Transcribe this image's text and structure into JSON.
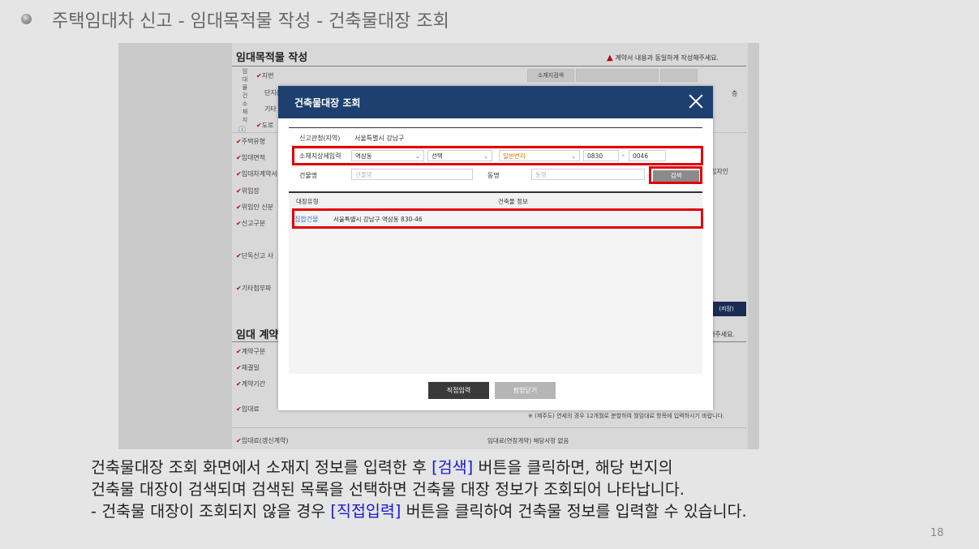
{
  "slide": {
    "title": "주택임대차 신고 - 임대목적물 작성 - 건축물대장 조회",
    "page_number": "18",
    "description": {
      "line1_a": "건축물대장 조회 화면에서 소재지 정보를 입력한 후 ",
      "line1_hl": "[검색]",
      "line1_b": " 버튼을 클릭하면, 해당 번지의",
      "line2": "건축물 대장이 검색되며 검색된 목록을 선택하면 건축물 대장 정보가 조회되어 나타납니다.",
      "line3_a": "- 건축물 대장이 조회되지 않을 경우 ",
      "line3_hl": "[직접입력]",
      "line3_b": " 버튼을 클릭하여 건축물 정보를 입력할 수 있습니다."
    }
  },
  "form": {
    "section1_title": "임대목적물 작성",
    "warning": "계약서 내용과 동일하게 작성해주세요.",
    "vertical_label": "임대물건소재지",
    "jibun_label": "지번",
    "danji_label": "단지(",
    "etc_label": "기타",
    "road_label": "도로",
    "search_address_btn": "소재지검색",
    "rows": [
      "주택유형",
      "임대면적",
      "임대차계약서",
      "위임장",
      "위임인 신분",
      "신고구분",
      "단독신고 사",
      "기타첨부파"
    ],
    "right_note": "임자인",
    "save_label": "(저장)",
    "section2_title": "임대 계약",
    "section2_warning": "해주세요.",
    "contract_rows": [
      "계약구분",
      "체결일",
      "계약기간",
      "임대료",
      "임대료(갱신계약)"
    ],
    "jeju_note": "※ (제주도) 연세의 경우 12개월로 분할하여 월임대료 항목에 입력하시기 바랍니다.",
    "renewal_note": "임대료(연장계약) 해당사항 없음",
    "item_suffix": "층"
  },
  "modal": {
    "title": "건축물대장 조회",
    "jurisdiction_label": "신고관청(지역)",
    "jurisdiction_value": "서울특별시 강남구",
    "address_detail_label": "소재지상세입력",
    "dong_select": "역삼동",
    "type_select": "선택",
    "bunji_select": "일반번지",
    "bun_value": "0830",
    "dash": "-",
    "ji_value": "0046",
    "building_name_label": "건물명",
    "building_name_placeholder": "건물명",
    "dong_label": "동명",
    "dong_placeholder": "동명",
    "search_button": "검색",
    "results_header_type": "대장유형",
    "results_header_info": "건축물 정보",
    "results": [
      {
        "type": "집합건물",
        "address": "서울특별시 강남구 역삼동 830-46"
      }
    ],
    "direct_input_button": "직접입력",
    "close_popup_button": "팝업닫기"
  },
  "colors": {
    "modal_header": "#1d4070",
    "highlight_box": "#e00000",
    "link_blue": "#2f7ad6",
    "desc_highlight": "#1a1ad6"
  }
}
